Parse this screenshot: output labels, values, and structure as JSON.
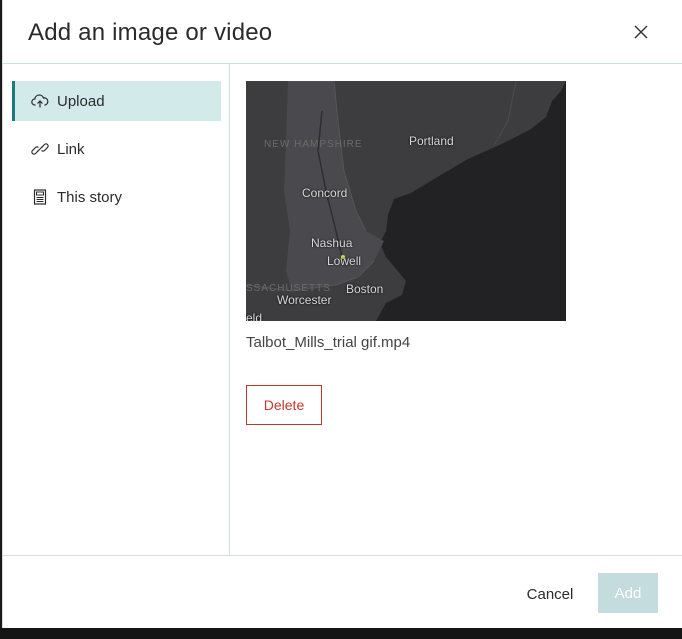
{
  "dialog": {
    "title": "Add an image or video",
    "close_icon": "close-icon"
  },
  "sidebar": {
    "items": [
      {
        "label": "Upload",
        "icon": "upload-cloud-icon",
        "active": true
      },
      {
        "label": "Link",
        "icon": "link-icon",
        "active": false
      },
      {
        "label": "This story",
        "icon": "story-icon",
        "active": false
      }
    ]
  },
  "media": {
    "filename": "Talbot_Mills_trial gif.mp4",
    "map_labels": [
      "Portland",
      "Concord",
      "Nashua",
      "Lowell",
      "Boston",
      "Worcester",
      "NEW HAMPSHIRE",
      "SSACHUSETTS",
      "eld"
    ],
    "delete_label": "Delete"
  },
  "footer": {
    "cancel_label": "Cancel",
    "add_label": "Add"
  },
  "colors": {
    "accent": "#1f7a80",
    "active_bg": "#d2eaea",
    "danger": "#c0392b",
    "disabled_bg": "#c4dcdd"
  }
}
